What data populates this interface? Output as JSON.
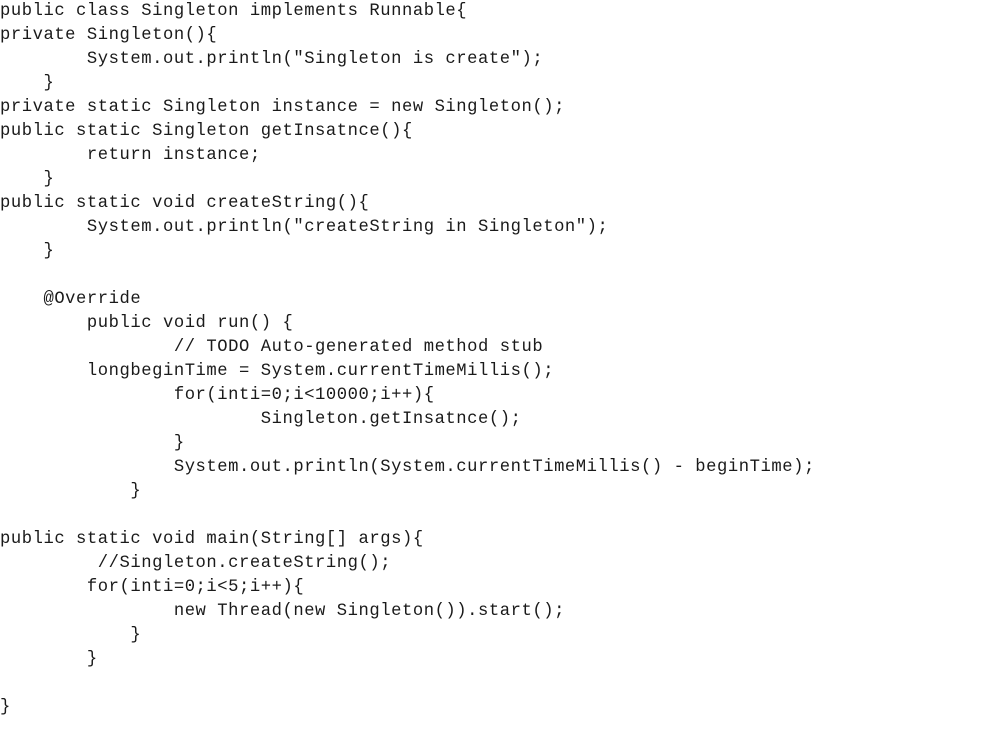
{
  "document": {
    "kind": "source-code-listing",
    "language": "Java",
    "class_name": "Singleton",
    "background_color": "#ffffff",
    "text_color": "#1a1a1a"
  },
  "code": {
    "lines": [
      "public class Singleton implements Runnable{",
      "private Singleton(){",
      "        System.out.println(\"Singleton is create\");",
      "    }",
      "private static Singleton instance = new Singleton();",
      "public static Singleton getInsatnce(){",
      "        return instance;",
      "    }",
      "public static void createString(){",
      "        System.out.println(\"createString in Singleton\");",
      "    }",
      "",
      "    @Override",
      "        public void run() {",
      "                // TODO Auto-generated method stub",
      "        longbeginTime = System.currentTimeMillis();",
      "                for(inti=0;i<10000;i++){",
      "                        Singleton.getInsatnce();",
      "                }",
      "                System.out.println(System.currentTimeMillis() - beginTime);",
      "            }",
      "",
      "public static void main(String[] args){",
      "         //Singleton.createString();",
      "        for(inti=0;i<5;i++){",
      "                new Thread(new Singleton()).start();",
      "            }",
      "        }",
      "",
      "}"
    ],
    "cutoff_line": "                                                                        "
  }
}
